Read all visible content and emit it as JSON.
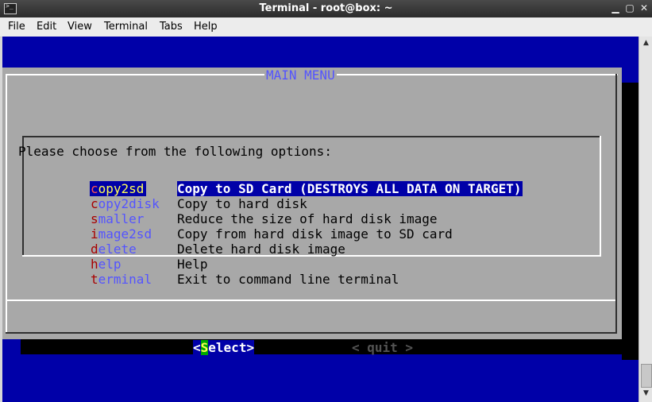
{
  "window": {
    "title": "Terminal - root@box: ~"
  },
  "menubar": [
    "File",
    "Edit",
    "View",
    "Terminal",
    "Tabs",
    "Help"
  ],
  "dialog": {
    "title": "MAIN MENU",
    "prompt": "Please choose from the following options:",
    "items": [
      {
        "first": "c",
        "rest": "opy2sd",
        "desc": "Copy to SD Card (DESTROYS ALL DATA ON TARGET)",
        "selected": true
      },
      {
        "first": "c",
        "rest": "opy2disk",
        "desc": "Copy to hard disk"
      },
      {
        "first": "s",
        "rest": "maller",
        "desc": "Reduce the size of hard disk image"
      },
      {
        "first": "i",
        "rest": "mage2sd",
        "desc": "Copy from hard disk image to SD card"
      },
      {
        "first": "d",
        "rest": "elete",
        "desc": "Delete hard disk image"
      },
      {
        "first": "h",
        "rest": "elp",
        "desc": "Help"
      },
      {
        "first": "t",
        "rest": "erminal",
        "desc": "Exit to command line terminal"
      }
    ],
    "buttons": {
      "select": {
        "open": "<",
        "hot": "S",
        "rest": "elect",
        "close": ">"
      },
      "quit": "< quit >"
    }
  },
  "colors": {
    "terminal_bg": "#0000a8",
    "dialog_bg": "#a8a8a8",
    "title_color": "#5454ff",
    "hotkey": "#a80000",
    "tag": "#5454ff",
    "select_hot_bg": "#00a800"
  },
  "icons": [
    "terminal-app-icon",
    "minimize-icon",
    "maximize-icon",
    "close-icon",
    "scroll-up-arrow-icon",
    "scroll-down-arrow-icon"
  ]
}
